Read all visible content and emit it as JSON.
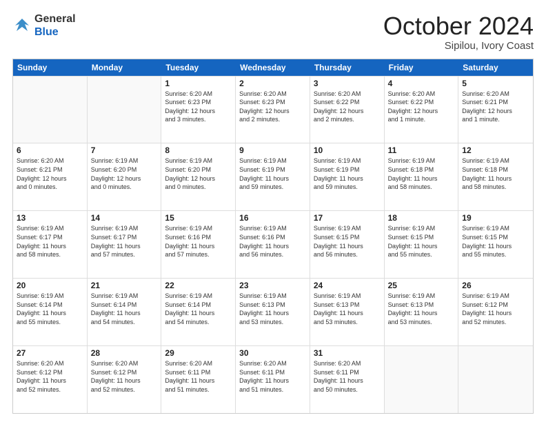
{
  "header": {
    "logo_line1": "General",
    "logo_line2": "Blue",
    "month_title": "October 2024",
    "location": "Sipilou, Ivory Coast"
  },
  "weekdays": [
    "Sunday",
    "Monday",
    "Tuesday",
    "Wednesday",
    "Thursday",
    "Friday",
    "Saturday"
  ],
  "rows": [
    [
      {
        "day": "",
        "info": ""
      },
      {
        "day": "",
        "info": ""
      },
      {
        "day": "1",
        "info": "Sunrise: 6:20 AM\nSunset: 6:23 PM\nDaylight: 12 hours\nand 3 minutes."
      },
      {
        "day": "2",
        "info": "Sunrise: 6:20 AM\nSunset: 6:23 PM\nDaylight: 12 hours\nand 2 minutes."
      },
      {
        "day": "3",
        "info": "Sunrise: 6:20 AM\nSunset: 6:22 PM\nDaylight: 12 hours\nand 2 minutes."
      },
      {
        "day": "4",
        "info": "Sunrise: 6:20 AM\nSunset: 6:22 PM\nDaylight: 12 hours\nand 1 minute."
      },
      {
        "day": "5",
        "info": "Sunrise: 6:20 AM\nSunset: 6:21 PM\nDaylight: 12 hours\nand 1 minute."
      }
    ],
    [
      {
        "day": "6",
        "info": "Sunrise: 6:20 AM\nSunset: 6:21 PM\nDaylight: 12 hours\nand 0 minutes."
      },
      {
        "day": "7",
        "info": "Sunrise: 6:19 AM\nSunset: 6:20 PM\nDaylight: 12 hours\nand 0 minutes."
      },
      {
        "day": "8",
        "info": "Sunrise: 6:19 AM\nSunset: 6:20 PM\nDaylight: 12 hours\nand 0 minutes."
      },
      {
        "day": "9",
        "info": "Sunrise: 6:19 AM\nSunset: 6:19 PM\nDaylight: 11 hours\nand 59 minutes."
      },
      {
        "day": "10",
        "info": "Sunrise: 6:19 AM\nSunset: 6:19 PM\nDaylight: 11 hours\nand 59 minutes."
      },
      {
        "day": "11",
        "info": "Sunrise: 6:19 AM\nSunset: 6:18 PM\nDaylight: 11 hours\nand 58 minutes."
      },
      {
        "day": "12",
        "info": "Sunrise: 6:19 AM\nSunset: 6:18 PM\nDaylight: 11 hours\nand 58 minutes."
      }
    ],
    [
      {
        "day": "13",
        "info": "Sunrise: 6:19 AM\nSunset: 6:17 PM\nDaylight: 11 hours\nand 58 minutes."
      },
      {
        "day": "14",
        "info": "Sunrise: 6:19 AM\nSunset: 6:17 PM\nDaylight: 11 hours\nand 57 minutes."
      },
      {
        "day": "15",
        "info": "Sunrise: 6:19 AM\nSunset: 6:16 PM\nDaylight: 11 hours\nand 57 minutes."
      },
      {
        "day": "16",
        "info": "Sunrise: 6:19 AM\nSunset: 6:16 PM\nDaylight: 11 hours\nand 56 minutes."
      },
      {
        "day": "17",
        "info": "Sunrise: 6:19 AM\nSunset: 6:15 PM\nDaylight: 11 hours\nand 56 minutes."
      },
      {
        "day": "18",
        "info": "Sunrise: 6:19 AM\nSunset: 6:15 PM\nDaylight: 11 hours\nand 55 minutes."
      },
      {
        "day": "19",
        "info": "Sunrise: 6:19 AM\nSunset: 6:15 PM\nDaylight: 11 hours\nand 55 minutes."
      }
    ],
    [
      {
        "day": "20",
        "info": "Sunrise: 6:19 AM\nSunset: 6:14 PM\nDaylight: 11 hours\nand 55 minutes."
      },
      {
        "day": "21",
        "info": "Sunrise: 6:19 AM\nSunset: 6:14 PM\nDaylight: 11 hours\nand 54 minutes."
      },
      {
        "day": "22",
        "info": "Sunrise: 6:19 AM\nSunset: 6:14 PM\nDaylight: 11 hours\nand 54 minutes."
      },
      {
        "day": "23",
        "info": "Sunrise: 6:19 AM\nSunset: 6:13 PM\nDaylight: 11 hours\nand 53 minutes."
      },
      {
        "day": "24",
        "info": "Sunrise: 6:19 AM\nSunset: 6:13 PM\nDaylight: 11 hours\nand 53 minutes."
      },
      {
        "day": "25",
        "info": "Sunrise: 6:19 AM\nSunset: 6:13 PM\nDaylight: 11 hours\nand 53 minutes."
      },
      {
        "day": "26",
        "info": "Sunrise: 6:19 AM\nSunset: 6:12 PM\nDaylight: 11 hours\nand 52 minutes."
      }
    ],
    [
      {
        "day": "27",
        "info": "Sunrise: 6:20 AM\nSunset: 6:12 PM\nDaylight: 11 hours\nand 52 minutes."
      },
      {
        "day": "28",
        "info": "Sunrise: 6:20 AM\nSunset: 6:12 PM\nDaylight: 11 hours\nand 52 minutes."
      },
      {
        "day": "29",
        "info": "Sunrise: 6:20 AM\nSunset: 6:11 PM\nDaylight: 11 hours\nand 51 minutes."
      },
      {
        "day": "30",
        "info": "Sunrise: 6:20 AM\nSunset: 6:11 PM\nDaylight: 11 hours\nand 51 minutes."
      },
      {
        "day": "31",
        "info": "Sunrise: 6:20 AM\nSunset: 6:11 PM\nDaylight: 11 hours\nand 50 minutes."
      },
      {
        "day": "",
        "info": ""
      },
      {
        "day": "",
        "info": ""
      }
    ]
  ]
}
